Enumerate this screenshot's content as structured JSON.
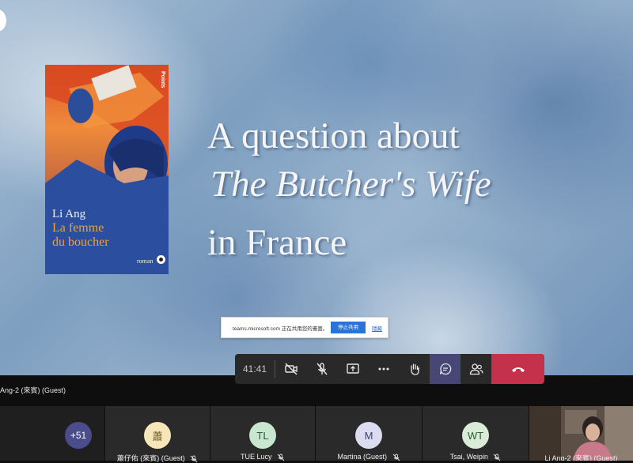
{
  "slide": {
    "line1": "A question about",
    "line2": "The Butcher's Wife",
    "line3": "in France"
  },
  "book": {
    "author": "Li Ang",
    "title_line1": "La femme",
    "title_line2": "du boucher",
    "series": "roman",
    "publisher": "Points"
  },
  "share_banner": {
    "message": "teams.microsoft.com 正在共用您的畫面。",
    "stop_label": "停止共用",
    "hide_label": "隱藏"
  },
  "call_bar": {
    "timer": "41:41",
    "buttons": [
      "camera-off-icon",
      "mic-off-icon",
      "share-screen-icon",
      "more-icon",
      "raise-hand-icon",
      "chat-icon",
      "participants-icon",
      "hang-up-icon"
    ],
    "active_color": "#464775",
    "hangup_color": "#c4314b"
  },
  "top_name": "Ang-2 (來賓) (Guest)",
  "gallery": {
    "overflow_count": "+51",
    "participants": [
      {
        "initials": "蕭",
        "name": "蕭仔佑 (來賓) (Guest)",
        "color": "#f6e6b9"
      },
      {
        "initials": "TL",
        "name": "TUE Lucy",
        "color": "#c8e6d0"
      },
      {
        "initials": "M",
        "name": "Martina (Guest)",
        "color": "#dcdcf0"
      },
      {
        "initials": "WT",
        "name": "Tsai, Weipin",
        "color": "#d8ecd8"
      }
    ],
    "self_name": "Li Ang-2 (來賓) (Guest)"
  }
}
